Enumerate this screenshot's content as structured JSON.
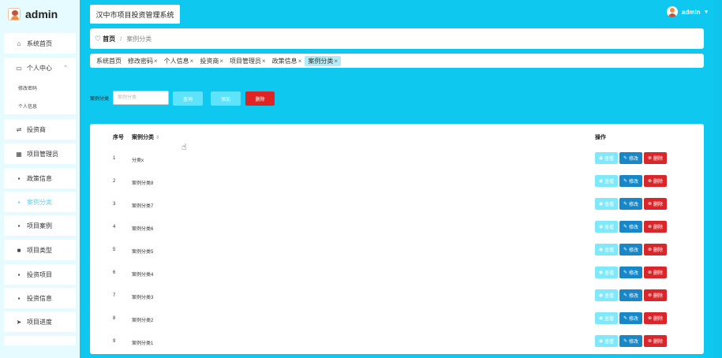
{
  "app": {
    "name": "admin",
    "system_title": "汉中市项目投资管理系统"
  },
  "user": {
    "name": "admin"
  },
  "sidebar": {
    "items": [
      {
        "label": "系统首页",
        "icon": "home-icon",
        "glyph": "⌂"
      },
      {
        "label": "个人中心",
        "icon": "user-center-icon",
        "glyph": "▭",
        "children": [
          "修改密码",
          "个人信息"
        ]
      },
      {
        "label": "投资商",
        "icon": "sliders-icon",
        "glyph": "⇌"
      },
      {
        "label": "项目管理员",
        "icon": "grid-icon",
        "glyph": "▦"
      },
      {
        "label": "政策信息",
        "icon": "apps-icon",
        "glyph": "▪"
      },
      {
        "label": "案例分类",
        "icon": "apps-icon",
        "glyph": "▪",
        "active": true
      },
      {
        "label": "项目案例",
        "icon": "apps-icon",
        "glyph": "▪"
      },
      {
        "label": "项目类型",
        "icon": "wallet-icon",
        "glyph": "■"
      },
      {
        "label": "投资项目",
        "icon": "apps-icon",
        "glyph": "▪"
      },
      {
        "label": "投资信息",
        "icon": "apps-icon",
        "glyph": "▪"
      },
      {
        "label": "项目进度",
        "icon": "send-icon",
        "glyph": "➤"
      }
    ]
  },
  "breadcrumb": {
    "home": "首页",
    "current": "案例分类"
  },
  "tabs": [
    "系统首页",
    "修改密码",
    "个人信息",
    "投资商",
    "项目管理员",
    "政策信息",
    "案例分类"
  ],
  "search": {
    "label": "案例分类",
    "placeholder": "案例分类",
    "query_label": "查询",
    "add_label": "添加",
    "delete_label": "删除"
  },
  "table": {
    "headers": {
      "index": "序号",
      "category": "案例分类",
      "actions": "操作"
    },
    "row_actions": {
      "view": "查看",
      "edit": "修改",
      "delete": "删除"
    },
    "rows": [
      {
        "index": "1",
        "category": "分类x"
      },
      {
        "index": "2",
        "category": "案例分类8"
      },
      {
        "index": "3",
        "category": "案例分类7"
      },
      {
        "index": "4",
        "category": "案例分类6"
      },
      {
        "index": "5",
        "category": "案例分类5"
      },
      {
        "index": "6",
        "category": "案例分类4"
      },
      {
        "index": "7",
        "category": "案例分类3"
      },
      {
        "index": "8",
        "category": "案例分类2"
      },
      {
        "index": "9",
        "category": "案例分类1"
      }
    ]
  },
  "colors": {
    "primary": "#0fc8f0",
    "sidebar_bg": "#e6fbff",
    "danger": "#e02424",
    "edit": "#1787c7",
    "light_button": "#5ee3fa"
  }
}
